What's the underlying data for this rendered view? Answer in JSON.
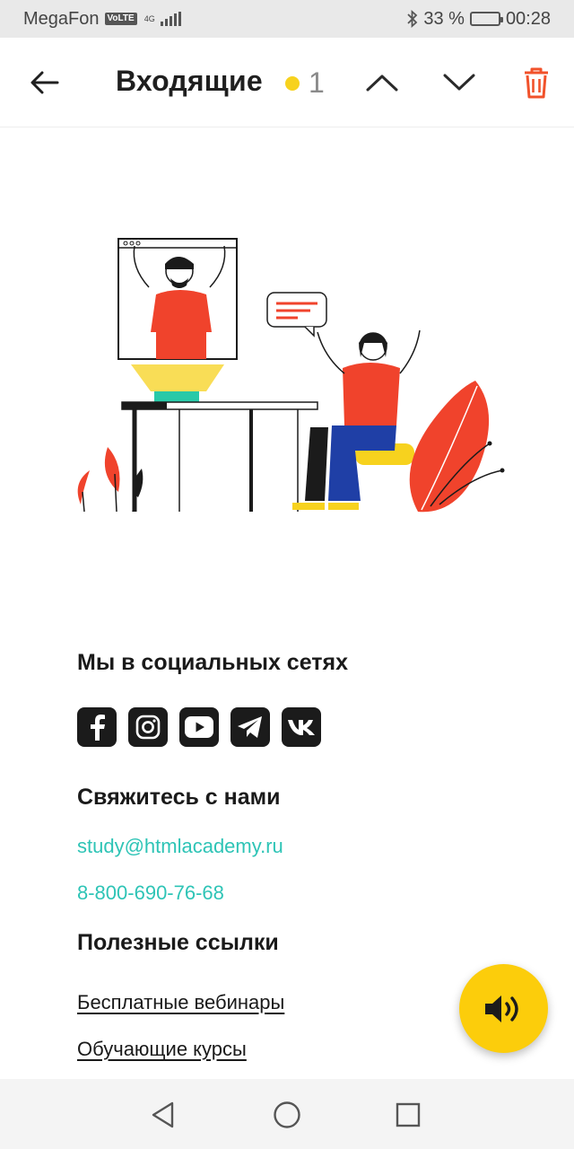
{
  "status_bar": {
    "carrier": "MegaFon",
    "volte": "VoLTE",
    "network": "4G",
    "battery_percent": "33 %",
    "battery_level": 0.33,
    "time": "00:28",
    "icons": [
      "bluetooth-icon",
      "battery-icon",
      "signal-icon"
    ]
  },
  "header": {
    "title": "Входящие",
    "unread_count": "1",
    "accent_color": "#f7d21e",
    "trash_color": "#f1522b"
  },
  "illustration": {
    "name": "video-call-illustration",
    "colors": {
      "red": "#f0432c",
      "blue": "#1f3fa6",
      "yellow": "#f7d21e",
      "teal": "#29c9a8",
      "dark": "#1b1b1b"
    }
  },
  "footer": {
    "social_heading": "Мы в социальных сетях",
    "socials": [
      {
        "name": "facebook-icon"
      },
      {
        "name": "instagram-icon"
      },
      {
        "name": "youtube-icon"
      },
      {
        "name": "telegram-icon"
      },
      {
        "name": "vk-icon"
      }
    ],
    "contact_heading": "Свяжитесь с нами",
    "email": "study@htmlacademy.ru",
    "phone": "8-800-690-76-68",
    "links_heading": "Полезные ссылки",
    "links": [
      "Бесплатные вебинары",
      "Обучающие курсы"
    ],
    "link_color": "#2ec4b6"
  },
  "fab": {
    "icon": "speaker-icon",
    "color": "#fccd0b"
  },
  "nav": {
    "icons": [
      "back-triangle-icon",
      "home-circle-icon",
      "recents-square-icon"
    ]
  }
}
